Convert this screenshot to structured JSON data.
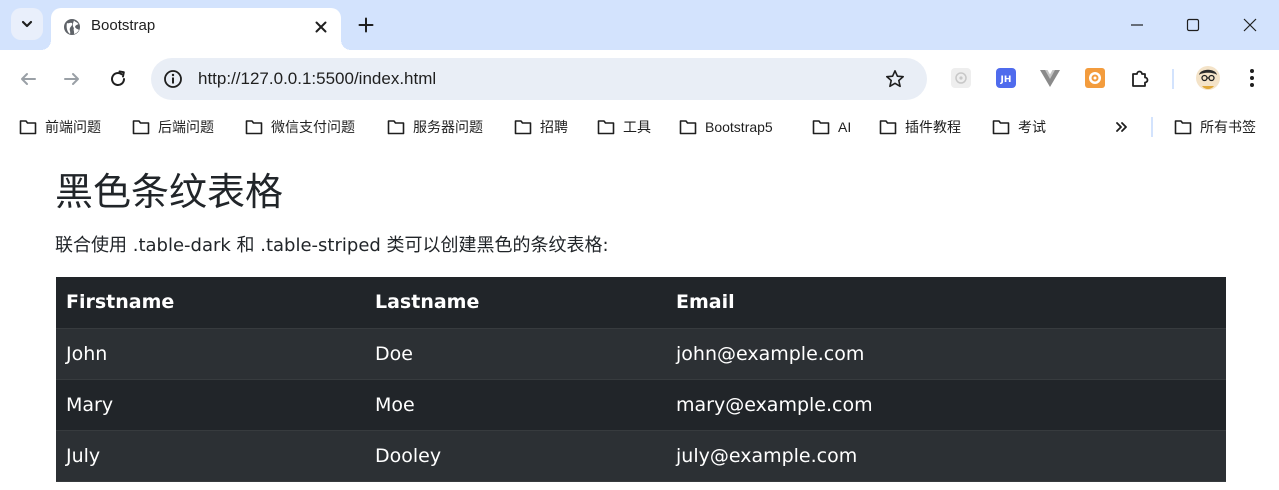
{
  "browser": {
    "tab": {
      "title": "Bootstrap"
    },
    "url": "http://127.0.0.1:5500/index.html",
    "colors": {
      "tabstrip": "#d3e3fd",
      "omnibox": "#e9eef6"
    }
  },
  "extensions": [
    "ai-extension-icon",
    "jh-extension-icon",
    "vue-devtools-icon",
    "orange-extension-icon",
    "puzzle-icon"
  ],
  "bookmarks": {
    "items": [
      {
        "label": "前端问题"
      },
      {
        "label": "后端问题"
      },
      {
        "label": "微信支付问题"
      },
      {
        "label": "服务器问题"
      },
      {
        "label": "招聘"
      },
      {
        "label": "工具"
      },
      {
        "label": "Bootstrap5"
      },
      {
        "label": "AI"
      },
      {
        "label": "插件教程"
      },
      {
        "label": "考试"
      }
    ],
    "all_bookmarks": "所有书签"
  },
  "page": {
    "title": "黑色条纹表格",
    "description": "联合使用 .table-dark 和 .table-striped 类可以创建黑色的条纹表格:",
    "table": {
      "headers": [
        "Firstname",
        "Lastname",
        "Email"
      ],
      "rows": [
        [
          "John",
          "Doe",
          "john@example.com"
        ],
        [
          "Mary",
          "Moe",
          "mary@example.com"
        ],
        [
          "July",
          "Dooley",
          "july@example.com"
        ]
      ],
      "colors": {
        "background": "#212529",
        "stripe": "#2c3034",
        "text": "#ffffff"
      }
    }
  }
}
